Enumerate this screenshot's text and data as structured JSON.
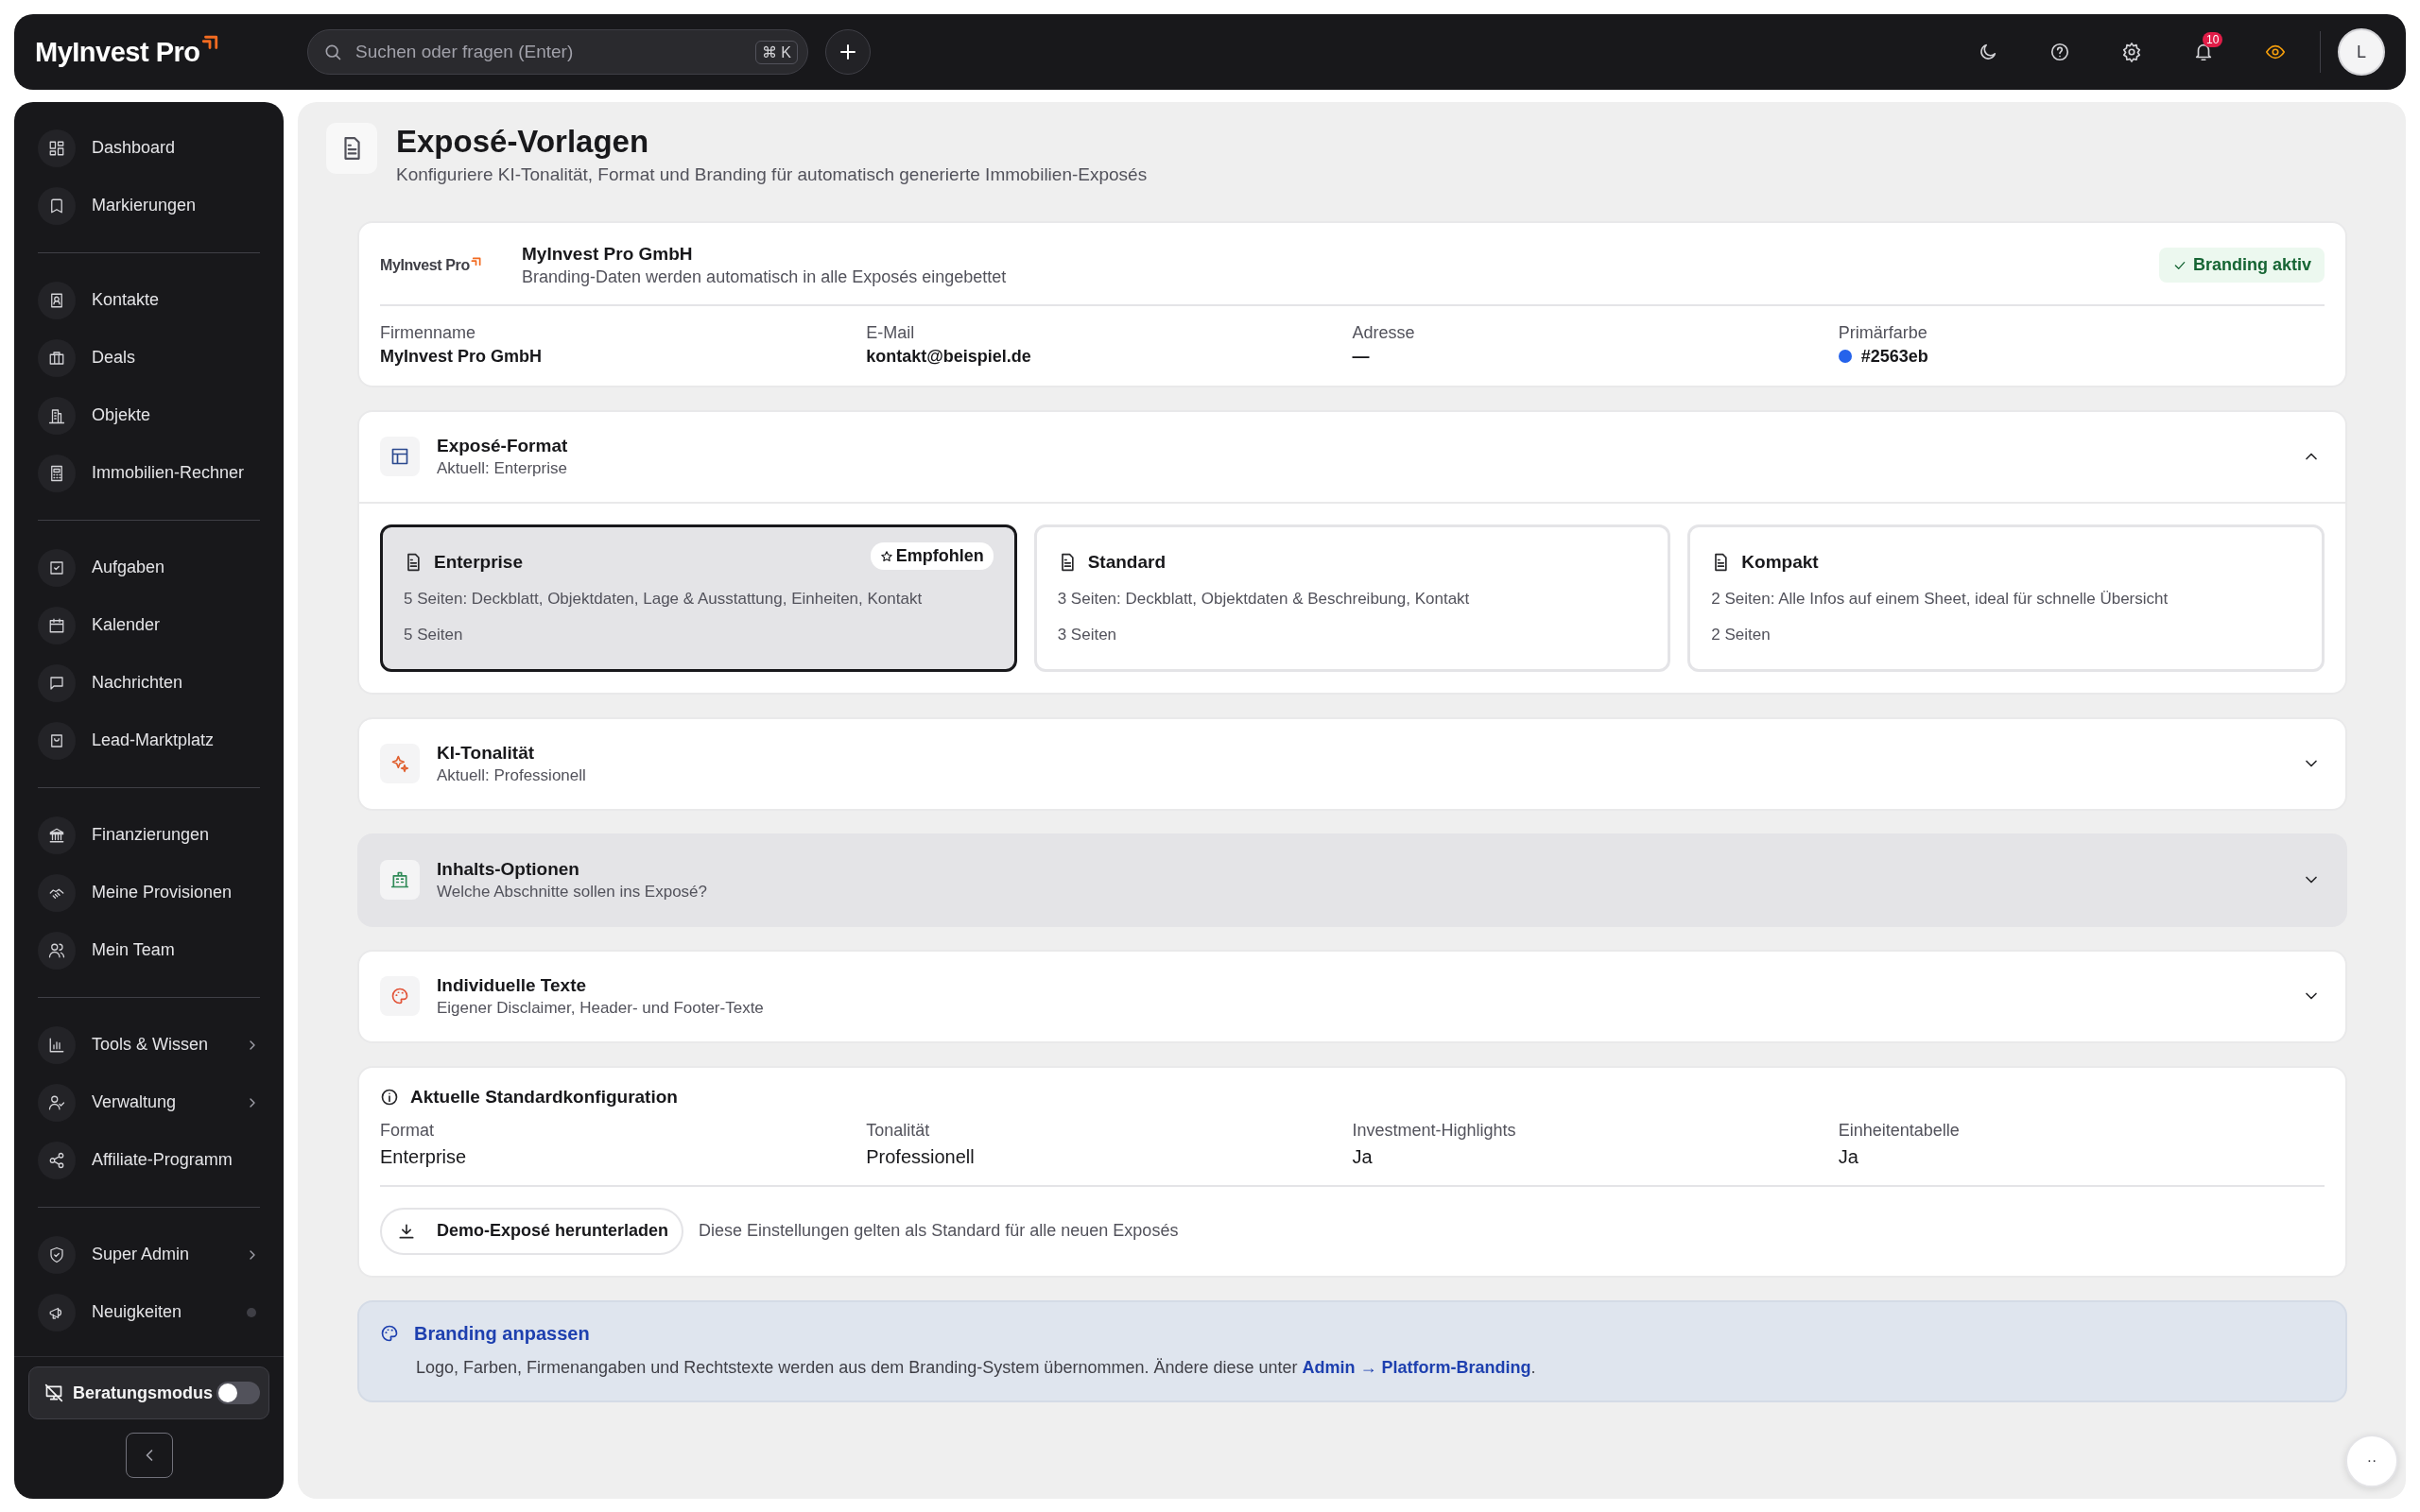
{
  "topbar": {
    "logo": "MyInvest Pro",
    "search": {
      "placeholder": "Suchen oder fragen (Enter)",
      "shortcut": "⌘ K"
    },
    "notifications": "10",
    "avatar": "L"
  },
  "sidebar": {
    "groups": [
      {
        "items": [
          {
            "label": "Dashboard",
            "selected": false,
            "has_submenu": false
          },
          {
            "label": "Markierungen",
            "selected": false,
            "has_submenu": false
          }
        ]
      },
      {
        "items": [
          {
            "label": "Kontakte",
            "selected": false,
            "has_submenu": false
          },
          {
            "label": "Deals",
            "selected": false,
            "has_submenu": false
          },
          {
            "label": "Objekte",
            "selected": false,
            "has_submenu": false
          },
          {
            "label": "Immobilien-Rechner",
            "selected": false,
            "has_submenu": false
          }
        ]
      },
      {
        "items": [
          {
            "label": "Aufgaben",
            "selected": false,
            "has_submenu": false
          },
          {
            "label": "Kalender",
            "selected": false,
            "has_submenu": false
          },
          {
            "label": "Nachrichten",
            "selected": false,
            "has_submenu": false
          },
          {
            "label": "Lead-Marktplatz",
            "selected": false,
            "has_submenu": false
          }
        ]
      },
      {
        "items": [
          {
            "label": "Finanzierungen",
            "selected": false,
            "has_submenu": false
          },
          {
            "label": "Meine Provisionen",
            "selected": false,
            "has_submenu": false
          },
          {
            "label": "Mein Team",
            "selected": false,
            "has_submenu": false
          }
        ]
      },
      {
        "items": [
          {
            "label": "Tools & Wissen",
            "selected": false,
            "has_submenu": true
          },
          {
            "label": "Verwaltung",
            "selected": false,
            "has_submenu": true
          },
          {
            "label": "Affiliate-Programm",
            "selected": false,
            "has_submenu": false
          }
        ]
      },
      {
        "items": [
          {
            "label": "Super Admin",
            "selected": false,
            "has_submenu": true
          },
          {
            "label": "Neuigkeiten",
            "selected": false,
            "has_submenu": false,
            "unread": true
          }
        ]
      }
    ],
    "advisor_mode": {
      "label": "Beratungsmodus",
      "on": false
    }
  },
  "page": {
    "title": "Exposé-Vorlagen",
    "subtitle": "Konfiguriere KI-Tonalität, Format und Branding für automatisch generierte Immobilien-Exposés"
  },
  "branding": {
    "logo": "MyInvest Pro",
    "name": "MyInvest Pro GmbH",
    "description": "Branding-Daten werden automatisch in alle Exposés eingebettet",
    "badge": "Branding aktiv",
    "fields": [
      {
        "label": "Firmenname",
        "value": "MyInvest Pro GmbH"
      },
      {
        "label": "E-Mail",
        "value": "kontakt@beispiel.de"
      },
      {
        "label": "Adresse",
        "value": "—"
      },
      {
        "label": "Primärfarbe",
        "value": "#2563eb",
        "color": "#2563eb"
      }
    ]
  },
  "sections": [
    {
      "title": "Exposé-Format",
      "subtitle": "Aktuell: Enterprise",
      "expanded": true,
      "highlighted": false,
      "color": "#2c4a8f",
      "options": [
        {
          "name": "Enterprise",
          "description": "5 Seiten: Deckblatt, Objektdaten, Lage & Ausstattung, Einheiten, Kontakt",
          "pages": "5 Seiten",
          "badge": "Empfohlen",
          "selected": true
        },
        {
          "name": "Standard",
          "description": "3 Seiten: Deckblatt, Objektdaten & Beschreibung, Kontakt",
          "pages": "3 Seiten",
          "selected": false
        },
        {
          "name": "Kompakt",
          "description": "2 Seiten: Alle Infos auf einem Sheet, ideal für schnelle Übersicht",
          "pages": "2 Seiten",
          "selected": false
        }
      ]
    },
    {
      "title": "KI-Tonalität",
      "subtitle": "Aktuell: Professionell",
      "expanded": false,
      "highlighted": false,
      "color": "#e0602f"
    },
    {
      "title": "Inhalts-Optionen",
      "subtitle": "Welche Abschnitte sollen ins Exposé?",
      "expanded": false,
      "highlighted": true,
      "color": "#2f8a57"
    },
    {
      "title": "Individuelle Texte",
      "subtitle": "Eigener Disclaimer, Header- und Footer-Texte",
      "expanded": false,
      "highlighted": false,
      "color": "#e2553a"
    }
  ],
  "config": {
    "title": "Aktuelle Standardkonfiguration",
    "fields": [
      {
        "label": "Format",
        "value": "Enterprise"
      },
      {
        "label": "Tonalität",
        "value": "Professionell"
      },
      {
        "label": "Investment-Highlights",
        "value": "Ja"
      },
      {
        "label": "Einheitentabelle",
        "value": "Ja"
      }
    ],
    "button": "Demo-Exposé herunterladen",
    "note": "Diese Einstellungen gelten als Standard für alle neuen Exposés"
  },
  "info": {
    "title": "Branding anpassen",
    "text": "Logo, Farben, Firmenangaben und Rechtstexte werden aus dem Branding-System übernommen. Ändere diese unter ",
    "link": "Admin → Platform-Branding",
    "after": "."
  },
  "help_button": "··"
}
